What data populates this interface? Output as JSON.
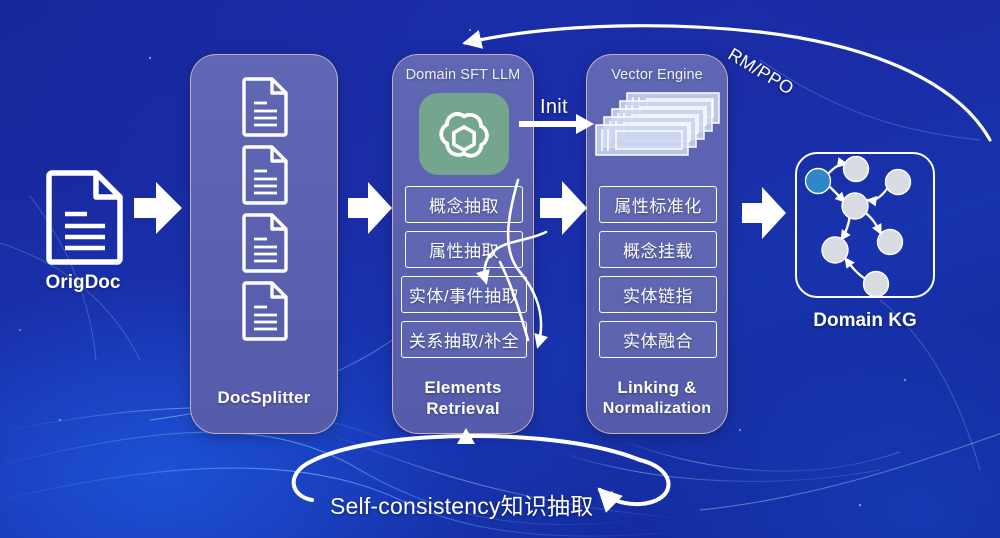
{
  "diagram": {
    "title": "Domain knowledge graph construction pipeline",
    "background_color": "#1a2ba3",
    "panel_color": "#5a60ae",
    "accent_white": "#ffffff",
    "llm_icon_color": "#74a58e",
    "kg_highlight_node_color": "#2f86c8"
  },
  "input": {
    "label": "OrigDoc",
    "icon": "document-icon"
  },
  "splitter": {
    "title": "DocSplitter",
    "doc_count": 4,
    "icon": "document-icon"
  },
  "elements_retrieval": {
    "header": "Domain SFT LLM",
    "model_icon": "openai-logo-icon",
    "items": [
      "概念抽取",
      "属性抽取",
      "实体/事件抽取",
      "关系抽取/补全"
    ],
    "title_line1": "Elements",
    "title_line2": "Retrieval"
  },
  "linking_normalization": {
    "header": "Vector Engine",
    "stack_icon": "layered-vectors-icon",
    "stack_layers": 5,
    "items": [
      "属性标准化",
      "概念挂载",
      "实体链指",
      "实体融合"
    ],
    "title_line1": "Linking &",
    "title_line2": "Normalization"
  },
  "output": {
    "label": "Domain KG",
    "graph_icon": "knowledge-graph-icon",
    "node_count": 7,
    "highlighted_nodes": 1
  },
  "edges": {
    "init": "Init",
    "feedback_top": "RM/PPO",
    "feedback_bottom": "Self-consistency知识抽取"
  },
  "arrows": {
    "doc_to_splitter": "block-arrow-right-icon",
    "splitter_to_retrieval": "block-arrow-right-icon",
    "retrieval_to_linking": "block-arrow-right-icon",
    "linking_to_kg": "block-arrow-right-icon"
  }
}
